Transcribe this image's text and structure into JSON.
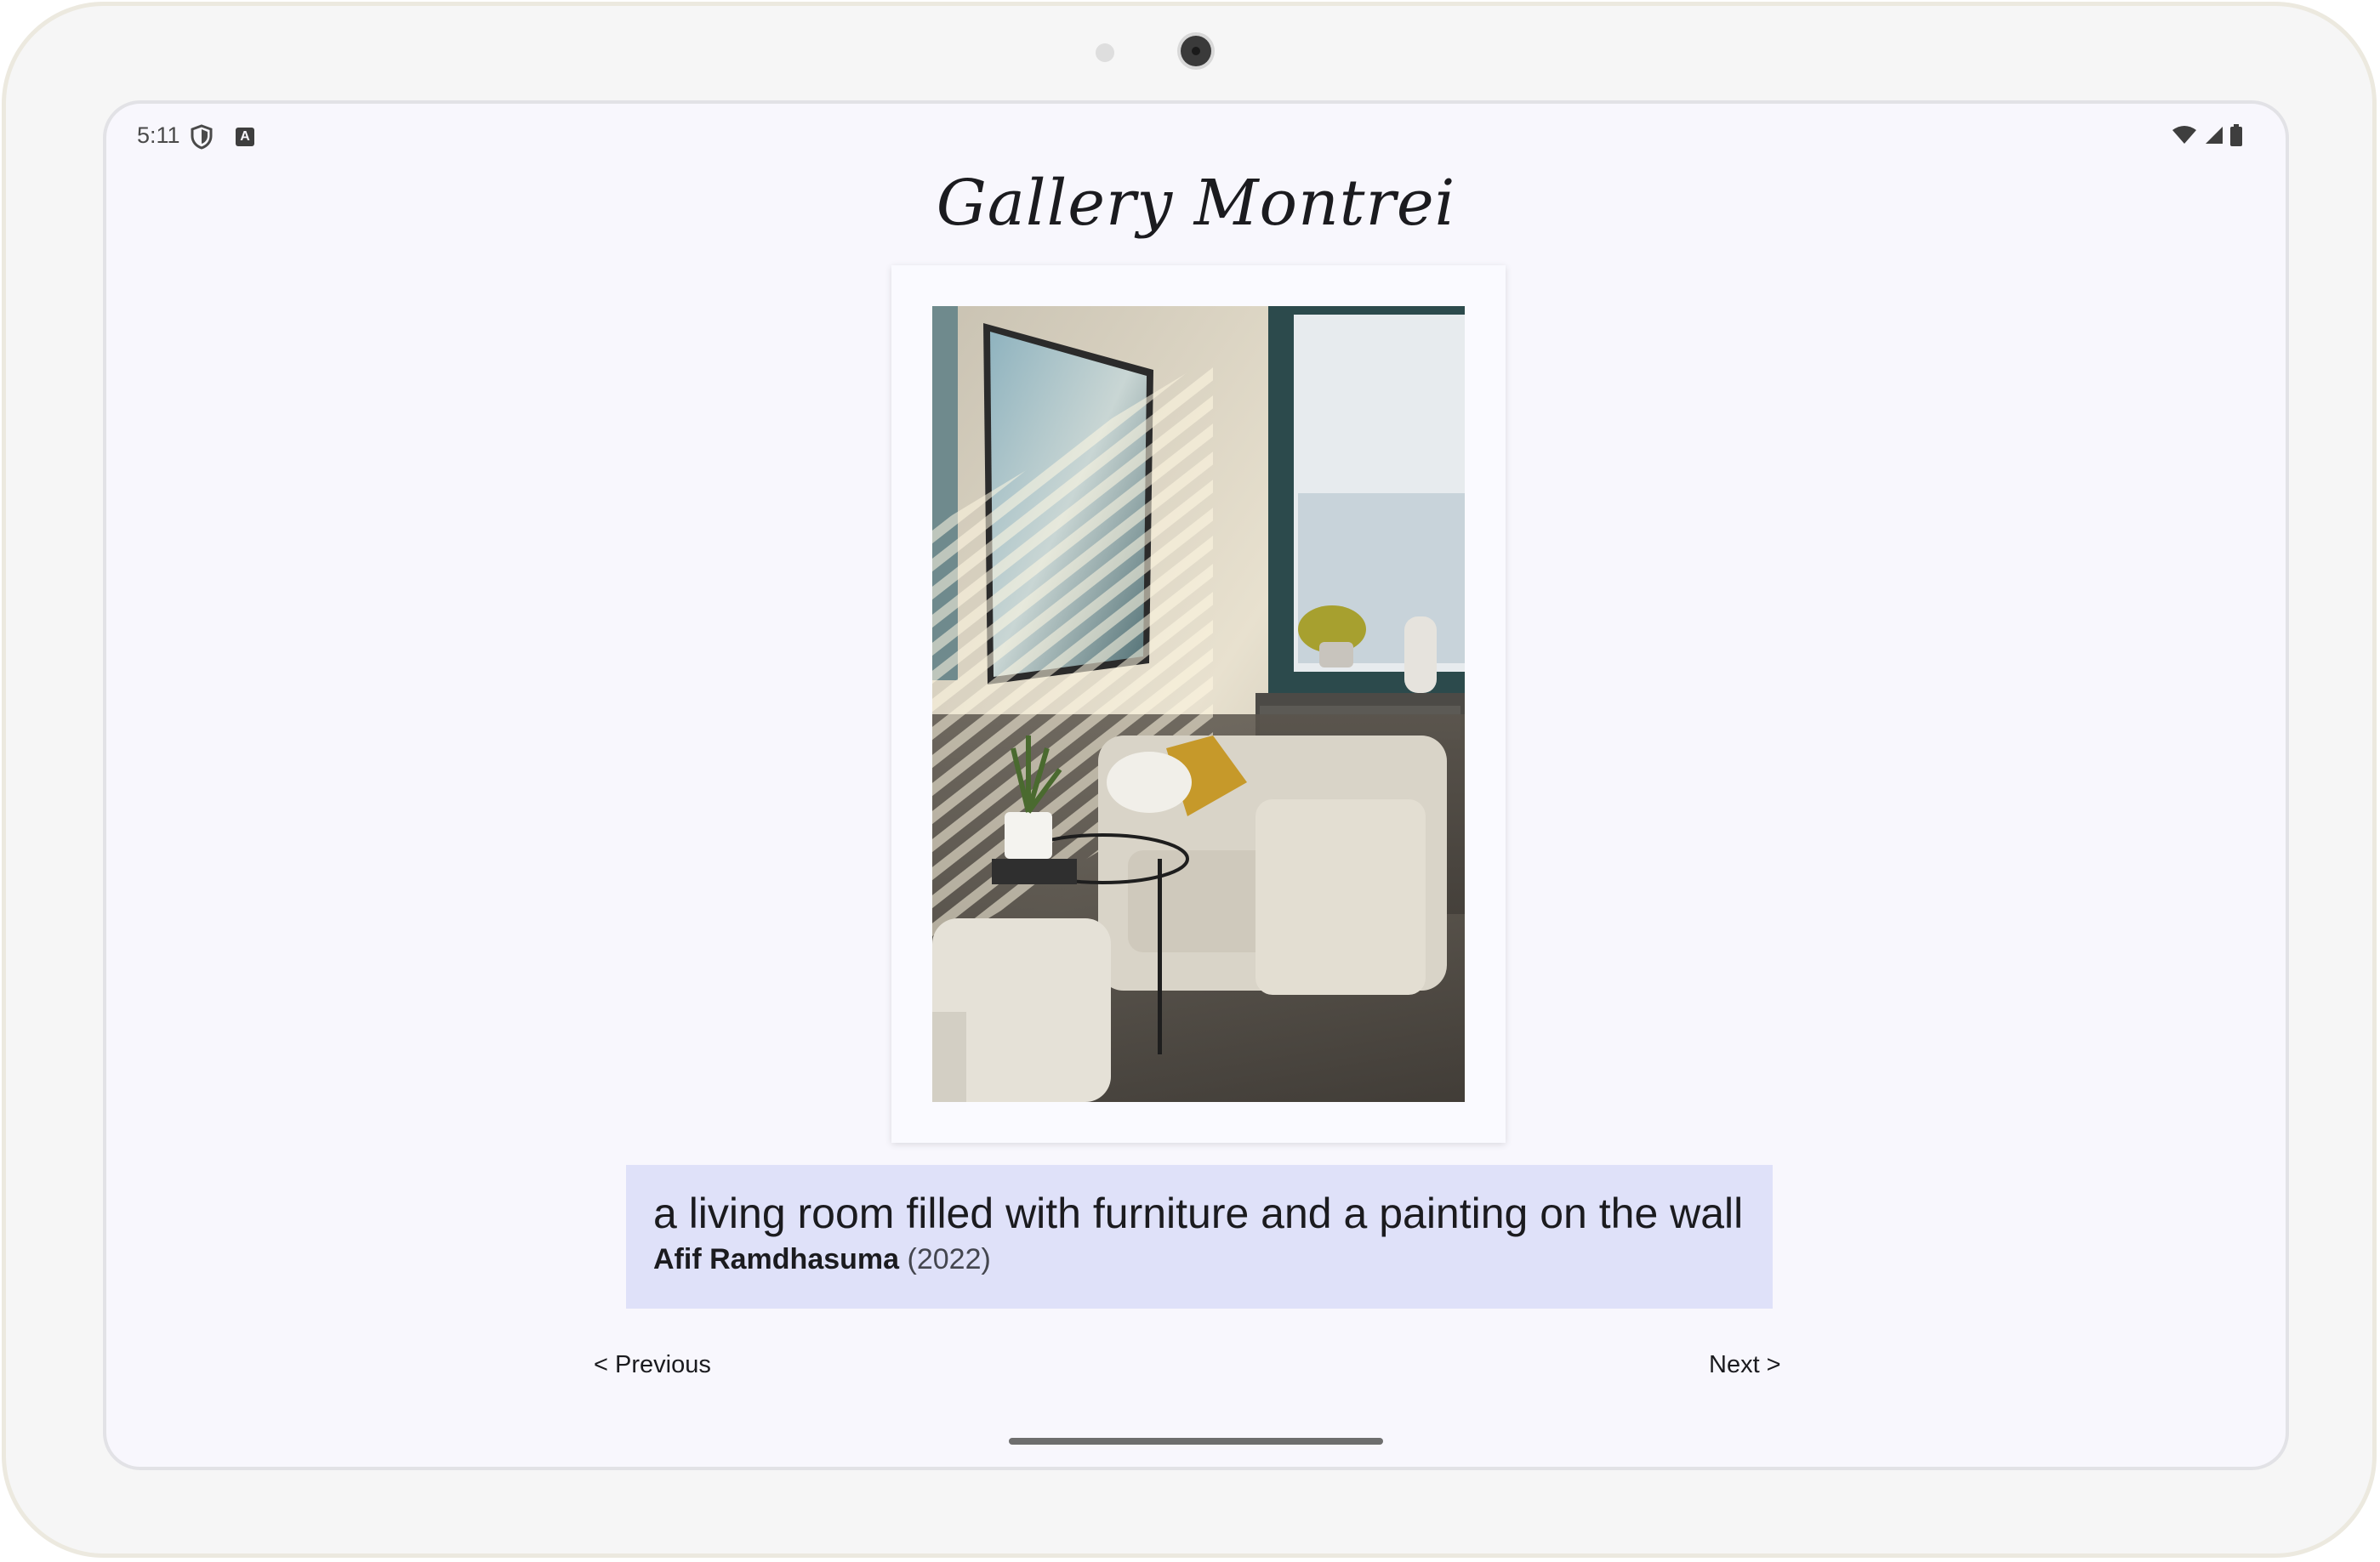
{
  "status_bar": {
    "time": "5:11"
  },
  "app": {
    "title": "Gallery Montrei"
  },
  "artwork": {
    "description": "a living room filled with furniture and a painting on the wall",
    "artist": "Afif Ramdhasuma",
    "year": "(2022)"
  },
  "navigation": {
    "previous_label": "< Previous",
    "next_label": "Next >"
  },
  "colors": {
    "caption_bg": "#dfe1f9",
    "screen_bg": "#f8f7fd"
  }
}
